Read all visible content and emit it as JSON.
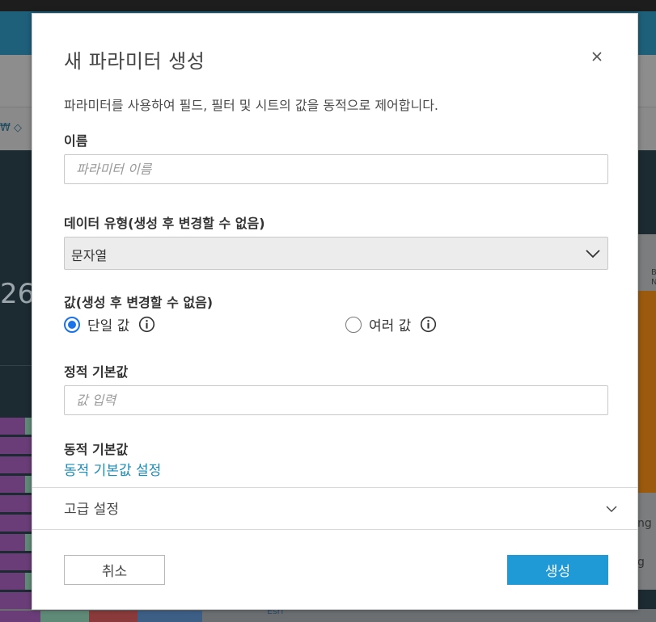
{
  "dialog": {
    "title": "새 파라미터 생성",
    "description": "파라미터를 사용하여 필드, 필터 및 시트의 값을 동적으로 제어합니다.",
    "name_label": "이름",
    "name_placeholder": "파라미터 이름",
    "data_type_label": "데이터 유형(생성 후 변경할 수 없음)",
    "data_type_value": "문자열",
    "values_label": "값(생성 후 변경할 수 없음)",
    "radio_single": "단일 값",
    "radio_multiple": "여러 값",
    "radio_selected": "단일 값",
    "static_default_label": "정적 기본값",
    "static_default_placeholder": "값 입력",
    "dynamic_default_label": "동적 기본값",
    "dynamic_default_link": "동적 기본값 설정",
    "advanced_settings": "고급 설정",
    "cancel_label": "취소",
    "create_label": "생성"
  },
  "background": {
    "partial_number": "26",
    "map_labels": [
      "B",
      "Na",
      "ng",
      "g"
    ],
    "map_attribution": "Esri",
    "toolbar_fragment": "₩ ◇"
  },
  "colors": {
    "accent": "#1f9ad6",
    "link": "#1a8bb5",
    "radio_selected": "#1a73e8",
    "header_bg": "#1e5f7a",
    "dash_bg": "#1c2a31"
  }
}
